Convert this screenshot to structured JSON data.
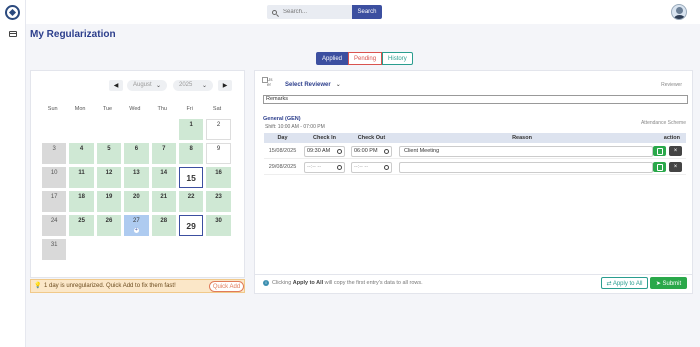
{
  "header": {
    "search_placeholder": "Search...",
    "search_button": "Search"
  },
  "page_title": "My Regularization",
  "tabs": [
    {
      "label": "Applied",
      "active": true
    },
    {
      "label": "Pending",
      "active": false
    },
    {
      "label": "History",
      "active": false
    }
  ],
  "calendar": {
    "prev_label": "◀",
    "next_label": "▶",
    "month": "August",
    "year": "2025",
    "weekdays": [
      "Sun",
      "Mon",
      "Tue",
      "Wed",
      "Thu",
      "Fri",
      "Sat"
    ],
    "days": [
      {
        "d": "",
        "s": "empty"
      },
      {
        "d": "",
        "s": "empty"
      },
      {
        "d": "",
        "s": "empty"
      },
      {
        "d": "",
        "s": "empty"
      },
      {
        "d": "",
        "s": "empty"
      },
      {
        "d": "1",
        "s": "green"
      },
      {
        "d": "2",
        "s": "white"
      },
      {
        "d": "3",
        "s": "grey"
      },
      {
        "d": "4",
        "s": "green"
      },
      {
        "d": "5",
        "s": "green"
      },
      {
        "d": "6",
        "s": "green"
      },
      {
        "d": "7",
        "s": "green"
      },
      {
        "d": "8",
        "s": "green"
      },
      {
        "d": "9",
        "s": "white"
      },
      {
        "d": "10",
        "s": "grey"
      },
      {
        "d": "11",
        "s": "green"
      },
      {
        "d": "12",
        "s": "green"
      },
      {
        "d": "13",
        "s": "green"
      },
      {
        "d": "14",
        "s": "green"
      },
      {
        "d": "15",
        "s": "sel"
      },
      {
        "d": "16",
        "s": "green"
      },
      {
        "d": "17",
        "s": "grey"
      },
      {
        "d": "18",
        "s": "green"
      },
      {
        "d": "19",
        "s": "green"
      },
      {
        "d": "20",
        "s": "green"
      },
      {
        "d": "21",
        "s": "green"
      },
      {
        "d": "22",
        "s": "green"
      },
      {
        "d": "23",
        "s": "green"
      },
      {
        "d": "24",
        "s": "grey"
      },
      {
        "d": "25",
        "s": "green"
      },
      {
        "d": "26",
        "s": "green"
      },
      {
        "d": "27",
        "s": "blue"
      },
      {
        "d": "28",
        "s": "green"
      },
      {
        "d": "29",
        "s": "sel"
      },
      {
        "d": "30",
        "s": "green"
      },
      {
        "d": "31",
        "s": "grey"
      }
    ]
  },
  "warning": {
    "text": "1 day is unregularized. Quick Add to fix them fast!",
    "button": "Quick Add"
  },
  "reviewer": {
    "img_alt": "Us er",
    "select_label": "Select Reviewer",
    "label": "Reviewer",
    "remarks": "Remarks"
  },
  "schedule": {
    "name": "General (GEN)",
    "time": "Shift: 10:00 AM - 07:00 PM",
    "label": "Attendance Scheme"
  },
  "table": {
    "headers": {
      "day": "Day",
      "check_in": "Check In",
      "check_out": "Check Out",
      "reason": "Reason",
      "action": "action"
    },
    "rows": [
      {
        "day": "15/08/2025",
        "check_in": "09:30 AM",
        "check_out": "06:00 PM",
        "reason": "Client Meeting",
        "in_empty": false,
        "out_empty": false
      },
      {
        "day": "29/08/2025",
        "check_in": "--:-- --",
        "check_out": "--:-- --",
        "reason": "",
        "in_empty": true,
        "out_empty": true
      }
    ]
  },
  "footer": {
    "info_pre": "Clicking ",
    "info_bold": "Apply to All",
    "info_post": " will copy the first entry's data to all rows.",
    "apply_all": "⇄ Apply to All",
    "submit": "➤ Submit"
  }
}
